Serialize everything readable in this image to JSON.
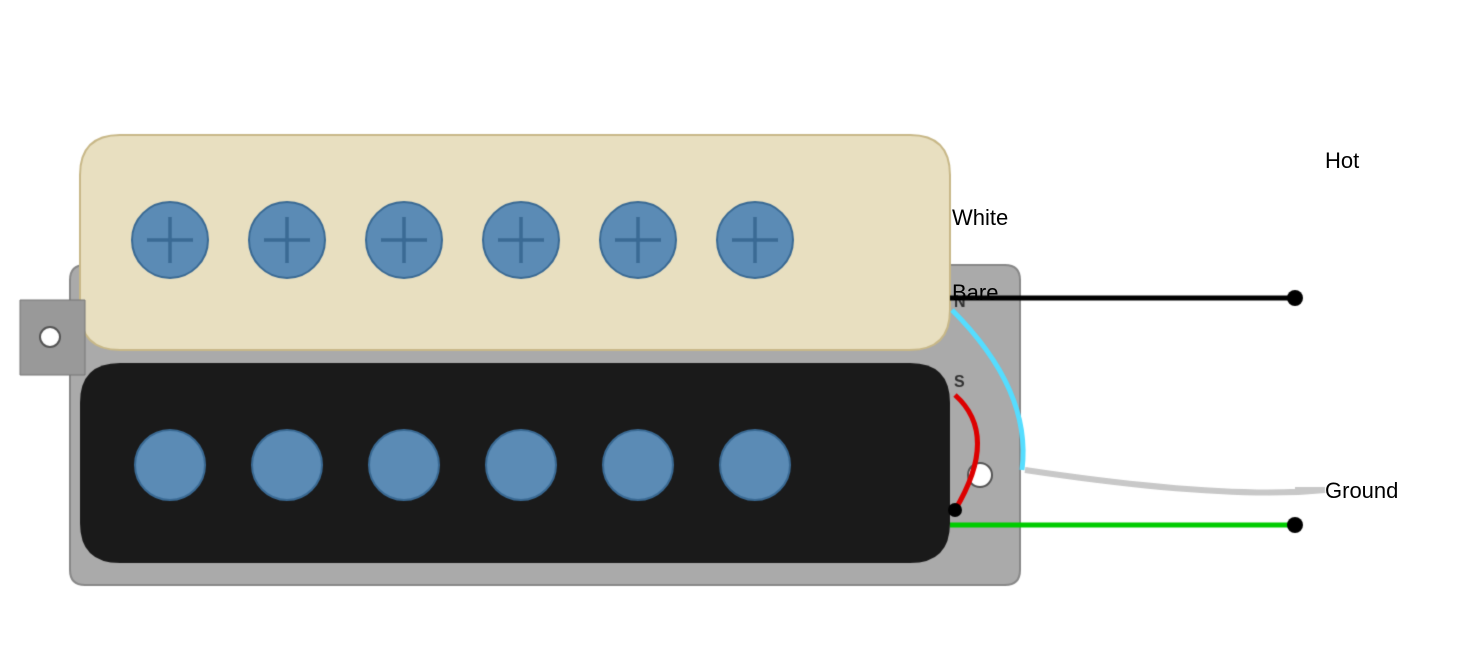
{
  "labels": {
    "hot": "Hot",
    "white": "White",
    "bare": "Bare",
    "ground": "Ground"
  },
  "colors": {
    "background": "#ffffff",
    "cream_pickup": "#e8dfc0",
    "black_pickup": "#1a1a1a",
    "metal_base": "#b0b0b0",
    "pole_piece": "#5b8bb5",
    "pole_piece_dark": "#4a7aa0",
    "wire_hot": "#000000",
    "wire_white": "#00bfff",
    "wire_bare": "#c0c0c0",
    "wire_green": "#00cc00",
    "wire_red": "#dd0000",
    "connector_dot": "#000000"
  }
}
